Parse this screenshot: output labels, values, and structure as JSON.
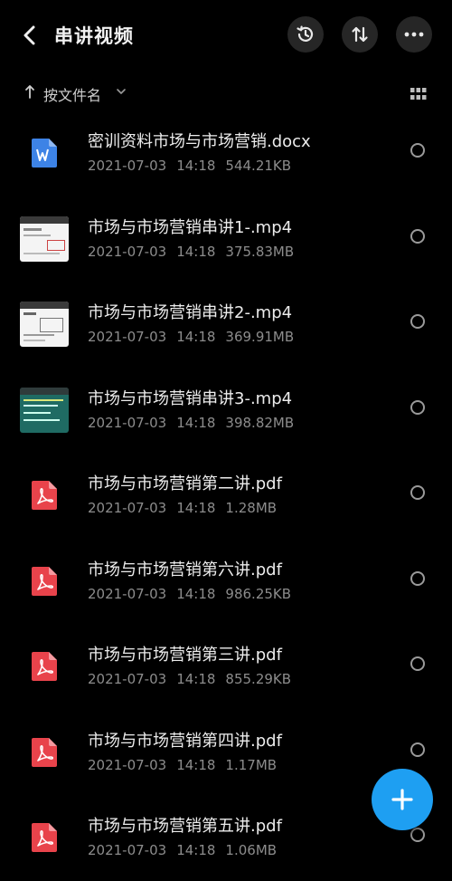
{
  "header": {
    "title": "串讲视频",
    "icons": [
      "back-icon",
      "history-icon",
      "sort-icon",
      "more-icon"
    ]
  },
  "sortbar": {
    "label": "按文件名",
    "icons": [
      "sort-arrow-up-icon",
      "chevron-down-icon",
      "grid-view-icon"
    ]
  },
  "files": [
    {
      "name": "密训资料市场与市场营销.docx",
      "date": "2021-07-03",
      "time": "14:18",
      "size": "544.21KB",
      "type": "docx"
    },
    {
      "name": "市场与市场营销串讲1-.mp4",
      "date": "2021-07-03",
      "time": "14:18",
      "size": "375.83MB",
      "type": "video"
    },
    {
      "name": "市场与市场营销串讲2-.mp4",
      "date": "2021-07-03",
      "time": "14:18",
      "size": "369.91MB",
      "type": "video"
    },
    {
      "name": "市场与市场营销串讲3-.mp4",
      "date": "2021-07-03",
      "time": "14:18",
      "size": "398.82MB",
      "type": "video"
    },
    {
      "name": "市场与市场营销第二讲.pdf",
      "date": "2021-07-03",
      "time": "14:18",
      "size": "1.28MB",
      "type": "pdf"
    },
    {
      "name": "市场与市场营销第六讲.pdf",
      "date": "2021-07-03",
      "time": "14:18",
      "size": "986.25KB",
      "type": "pdf"
    },
    {
      "name": "市场与市场营销第三讲.pdf",
      "date": "2021-07-03",
      "time": "14:18",
      "size": "855.29KB",
      "type": "pdf"
    },
    {
      "name": "市场与市场营销第四讲.pdf",
      "date": "2021-07-03",
      "time": "14:18",
      "size": "1.17MB",
      "type": "pdf"
    },
    {
      "name": "市场与市场营销第五讲.pdf",
      "date": "2021-07-03",
      "time": "14:18",
      "size": "1.06MB",
      "type": "pdf"
    }
  ],
  "fab": {
    "icon": "plus-icon"
  },
  "colors": {
    "background": "#000000",
    "accent": "#1e9ff2",
    "pdf": "#e8434b",
    "docx": "#3d83e6"
  }
}
